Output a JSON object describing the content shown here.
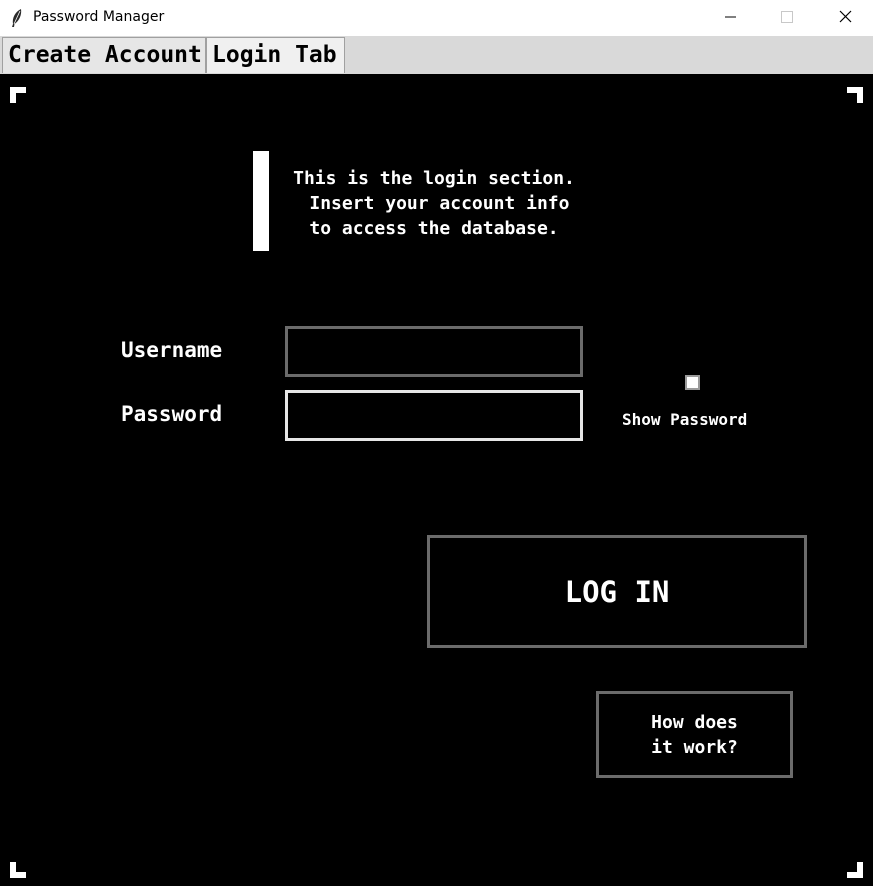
{
  "window": {
    "title": "Password Manager",
    "app_icon": "feather-icon",
    "controls": {
      "minimize_icon": "minimize-icon",
      "maximize_icon": "maximize-icon",
      "close_icon": "close-icon"
    }
  },
  "tabs": [
    {
      "label": "Create Account",
      "selected": false
    },
    {
      "label": "Login Tab",
      "selected": true
    }
  ],
  "login": {
    "info_text": "This is the login section.\n Insert your account info\nto access the database.",
    "username_label": "Username",
    "username_value": "",
    "password_label": "Password",
    "password_value": "",
    "show_password_label": "Show Password",
    "show_password_checked": false,
    "login_button": "LOG IN",
    "help_button": "How does\nit work?"
  },
  "colors": {
    "background": "#000000",
    "text": "#ffffff",
    "border_inactive": "#6b6b6b",
    "border_focus": "#e6e6e6"
  }
}
